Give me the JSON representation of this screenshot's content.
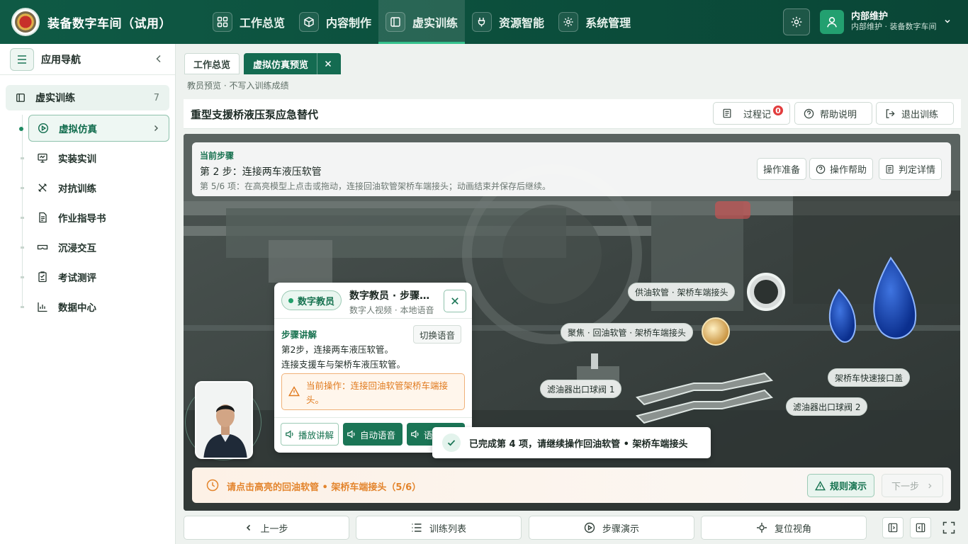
{
  "app": {
    "title": "装备数字车间（试用）"
  },
  "nav": [
    {
      "label": "工作总览",
      "icon": "grid-icon"
    },
    {
      "label": "内容制作",
      "icon": "cube-icon"
    },
    {
      "label": "虚实训练",
      "icon": "book-icon",
      "active": true
    },
    {
      "label": "资源智能",
      "icon": "plug-icon"
    },
    {
      "label": "系统管理",
      "icon": "gear-icon"
    }
  ],
  "user": {
    "name": "内部维护",
    "subtitle": "内部维护 · 装备数字车间"
  },
  "sidebar": {
    "title": "应用导航",
    "group": {
      "label": "虚实训练",
      "count": "7"
    },
    "items": [
      {
        "label": "虚拟仿真",
        "icon": "play-circle-icon",
        "active": true
      },
      {
        "label": "实装实训",
        "icon": "monitor-icon"
      },
      {
        "label": "对抗训练",
        "icon": "swords-icon"
      },
      {
        "label": "作业指导书",
        "icon": "document-icon"
      },
      {
        "label": "沉浸交互",
        "icon": "vr-glasses-icon"
      },
      {
        "label": "考试测评",
        "icon": "exam-icon"
      },
      {
        "label": "数据中心",
        "icon": "chart-icon"
      }
    ]
  },
  "tabs": [
    {
      "label": "工作总览"
    },
    {
      "label": "虚拟仿真预览",
      "active": true
    }
  ],
  "subnote": "教员预览 · 不写入训练成绩",
  "page": {
    "title": "重型支援桥液压泵应急替代",
    "buttons": {
      "process": "过程记",
      "process_badge": "0",
      "help": "帮助说明",
      "exit": "退出训练"
    }
  },
  "step": {
    "label": "当前步骤",
    "title": "第 2 步：连接两车液压软管",
    "desc": "第 5/6 项：在高亮模型上点击或拖动，连接回油软管架桥车端接头；动画结束并保存后继续。",
    "buttons": {
      "prep": "操作准备",
      "help": "操作帮助",
      "detail": "判定详情"
    }
  },
  "hotspots": [
    "供油软管 · 架桥车端接头",
    "聚焦 · 回油软管 · 架桥车端接头",
    "滤油器出口球阀 1",
    "架桥车快速接口盖",
    "滤油器出口球阀 2"
  ],
  "tutor": {
    "pill": "数字教员",
    "name": "数字教员 · 步骤讲解",
    "meta": "数字人视频 · 本地语音",
    "section": "步骤讲解",
    "switch_voice": "切换语音",
    "line1": "第2步，连接两车液压软管。",
    "line2": "连接支援车与架桥车液压软管。",
    "warning": "当前操作：连接回油软管架桥车端接头。",
    "btn_play": "播放讲解",
    "btn_auto": "自动语音",
    "btn_third": "语音"
  },
  "toast": "已完成第 4 项，请继续操作回油软管 • 架桥车端接头",
  "hint": {
    "text": "请点击高亮的回油软管 • 架桥车端接头（5/6）",
    "demo": "规则演示",
    "next": "下一步"
  },
  "bottom": {
    "prev": "上一步",
    "list": "训练列表",
    "demo": "步骤演示",
    "reset": "复位视角"
  },
  "colors": {
    "primary": "#146b51",
    "accent": "#35c28d",
    "warning": "#e3842c",
    "badge": "#e23d3d"
  }
}
